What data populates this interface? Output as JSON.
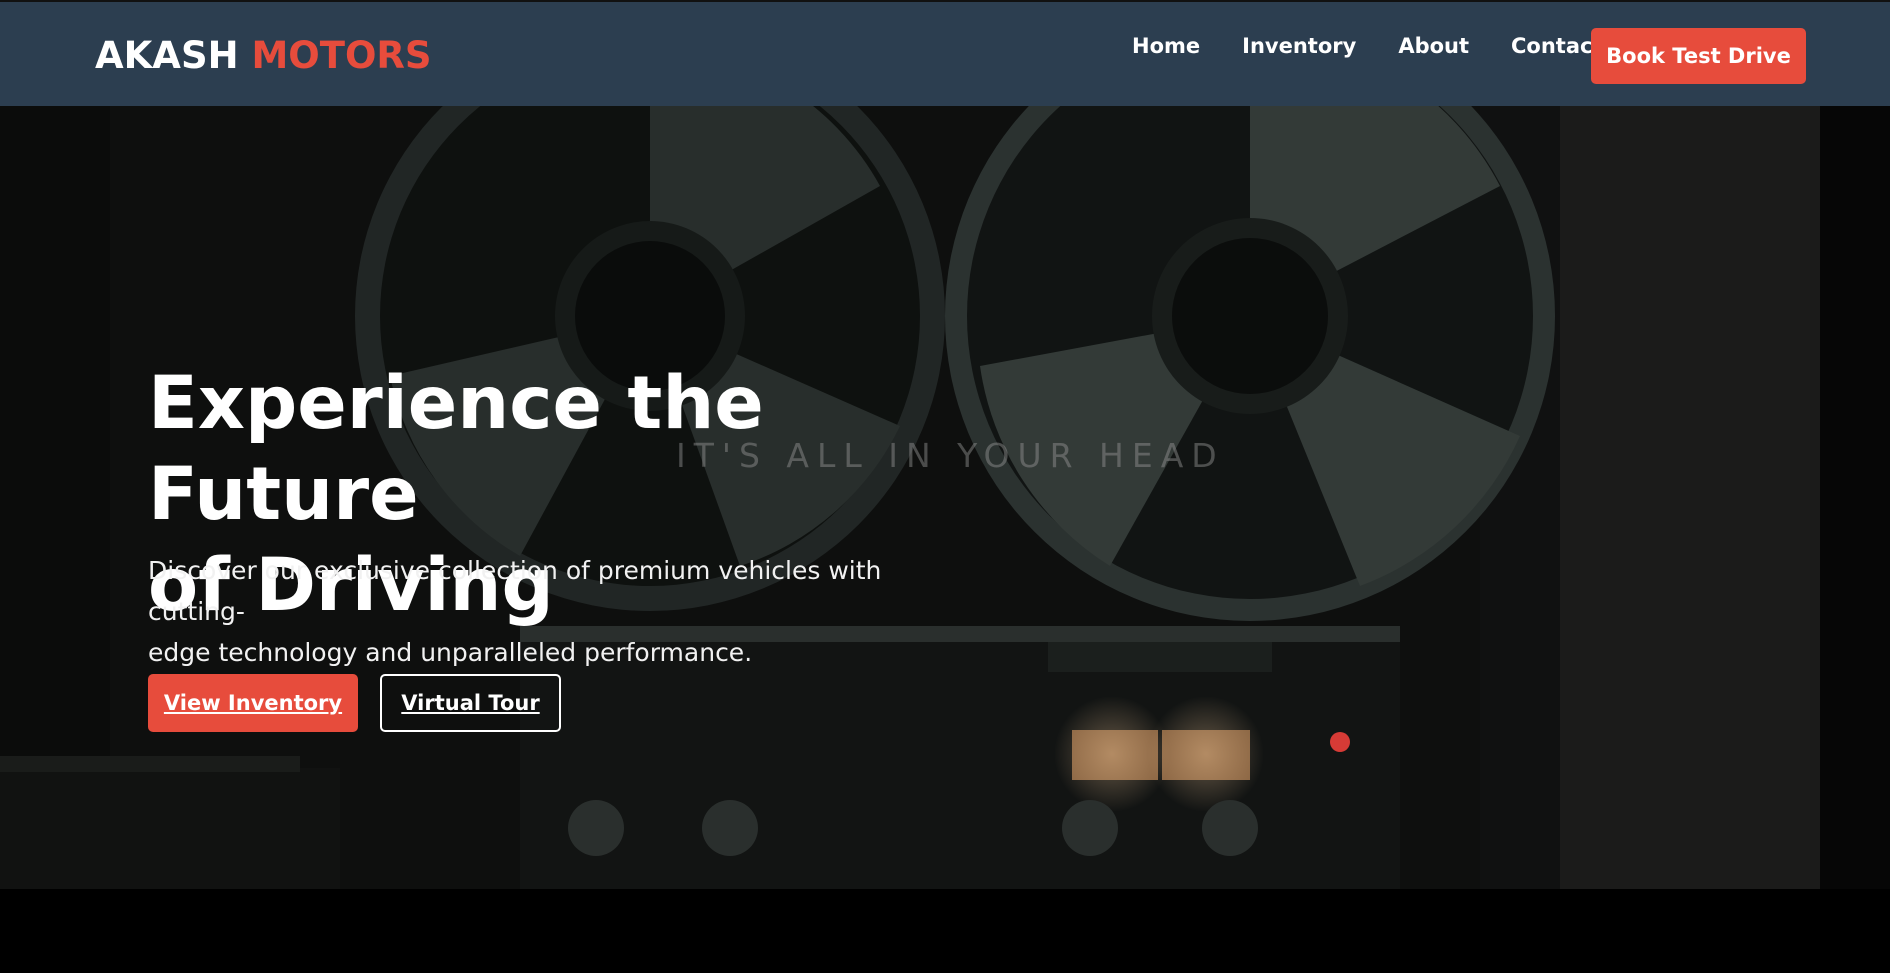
{
  "nav": {
    "logo_main": "AKASH",
    "logo_accent": "MOTORS",
    "links": [
      "Home",
      "Inventory",
      "About",
      "Contact"
    ],
    "cta_label": "Book Test Drive"
  },
  "hero": {
    "title_line1": "Experience the Future",
    "title_line2": "of Driving",
    "subtitle_line1": "Discover our exclusive collection of premium vehicles with cutting-",
    "subtitle_line2": "edge technology and unparalleled performance.",
    "primary_button": "View Inventory",
    "secondary_button": "Virtual Tour",
    "background_tagline": "IT'S ALL IN YOUR HEAD"
  },
  "colors": {
    "navbar": "#2c3e50",
    "accent": "#e74c3c",
    "text": "#ffffff"
  }
}
